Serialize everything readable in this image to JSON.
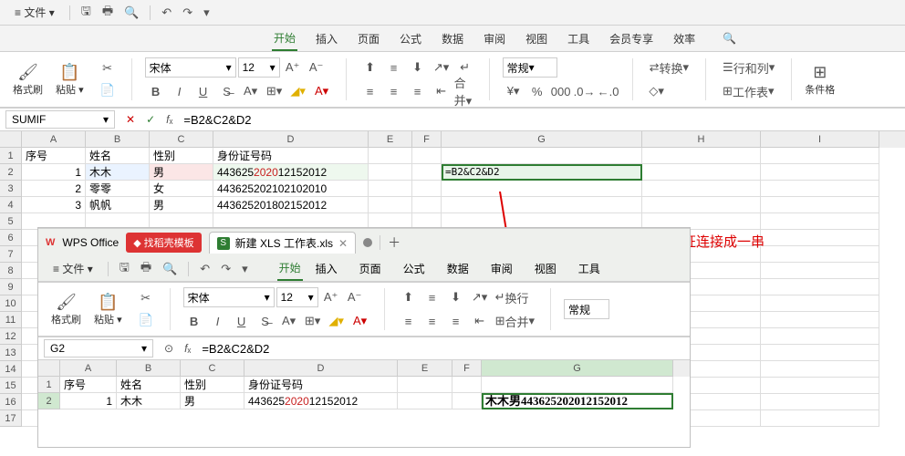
{
  "outer": {
    "menu": {
      "file": "文件",
      "dd": "▾"
    },
    "tabs": {
      "start": "开始",
      "insert": "插入",
      "layout": "页面",
      "formula": "公式",
      "data": "数据",
      "review": "审阅",
      "view": "视图",
      "tools": "工具",
      "member": "会员专享",
      "efficiency": "效率"
    },
    "ribbon": {
      "format_painter": "格式刷",
      "paste": "粘贴",
      "paste_dd": "▾",
      "font": "宋体",
      "font_size": "12",
      "normal": "常规",
      "convert": "转换",
      "rows_cols": "行和列",
      "worksheet": "工作表",
      "cond_fmt": "条件格"
    },
    "fx": {
      "name": "SUMIF",
      "formula": "=B2&C2&D2"
    },
    "cols": {
      "A": "A",
      "B": "B",
      "C": "C",
      "D": "D",
      "E": "E",
      "F": "F",
      "G": "G",
      "H": "H",
      "I": "I"
    },
    "headers": {
      "seq": "序号",
      "name": "姓名",
      "sex": "性别",
      "id": "身份证号码"
    },
    "rows": [
      {
        "n": "1",
        "name": "木木",
        "sex": "男",
        "id_a": "443625",
        "id_b": "2020",
        "id_c": "12152012"
      },
      {
        "n": "2",
        "name": "零零",
        "sex": "女",
        "id_a": "443625",
        "id_b": "2021",
        "id_c": "02102010"
      },
      {
        "n": "3",
        "name": "帆帆",
        "sex": "男",
        "id_a": "443625",
        "id_b": "2018",
        "id_c": "02152012"
      }
    ],
    "g2": "=B2&C2&D2"
  },
  "inner": {
    "wps": "WPS Office",
    "tpl": "找稻壳模板",
    "file": "新建 XLS 工作表.xls",
    "menu": {
      "file": "文件",
      "dd": "▾"
    },
    "tabs": {
      "start": "开始",
      "insert": "插入",
      "layout": "页面",
      "formula": "公式",
      "data": "数据",
      "review": "审阅",
      "view": "视图",
      "tools": "工具"
    },
    "ribbon": {
      "format_painter": "格式刷",
      "paste": "粘贴",
      "paste_dd": "▾",
      "font": "宋体",
      "font_size": "12",
      "wrap": "换行",
      "merge": "合并",
      "normal": "常规"
    },
    "fx": {
      "name": "G2",
      "formula": "=B2&C2&D2"
    },
    "cols": {
      "A": "A",
      "B": "B",
      "C": "C",
      "D": "D",
      "E": "E",
      "F": "F",
      "G": "G"
    },
    "headers": {
      "seq": "序号",
      "name": "姓名",
      "sex": "性别",
      "id": "身份证号码"
    },
    "row2": {
      "n": "1",
      "name": "木木",
      "sex": "男",
      "id_a": "443625",
      "id_b": "2020",
      "id_c": "12152012",
      "result": "木木男443625202012152012"
    }
  },
  "annotation": "回车后，得到姓名性别身份证连接成一串"
}
